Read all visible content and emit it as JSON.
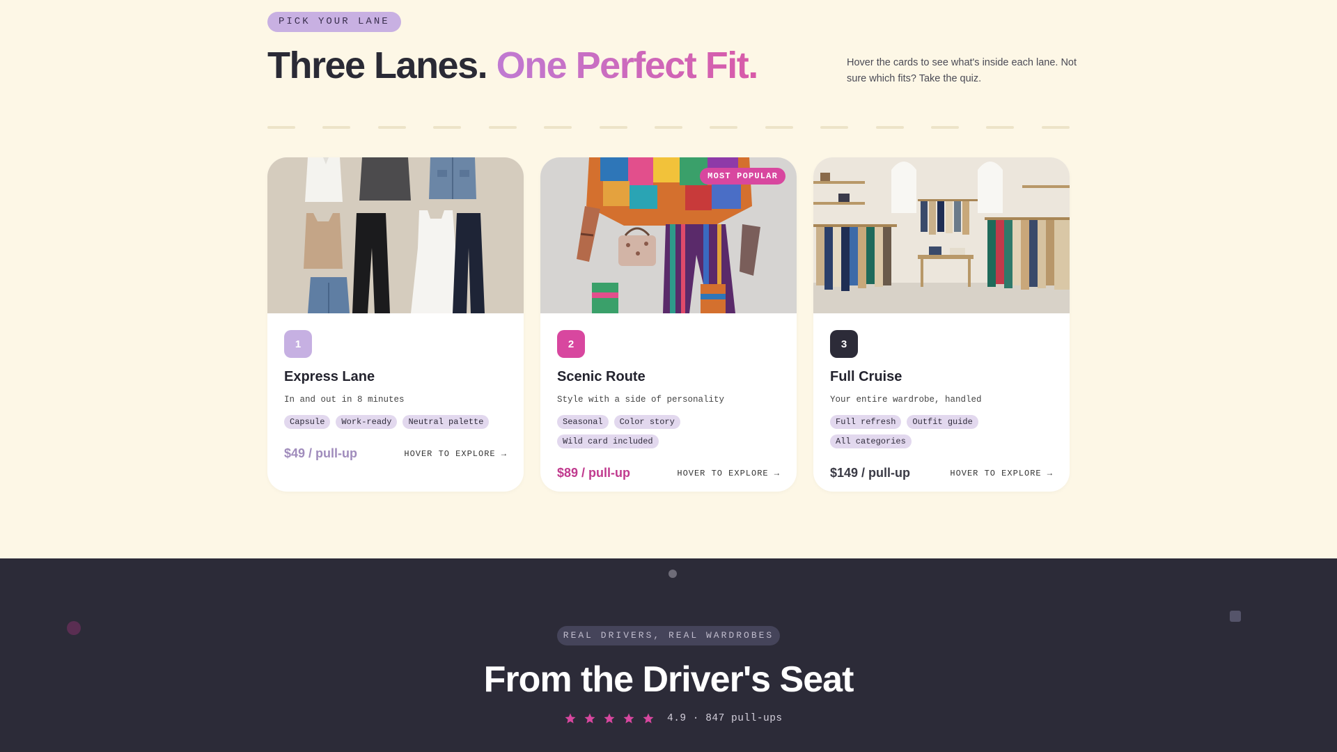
{
  "header": {
    "eyebrow": "PICK YOUR LANE",
    "headline_part1": "Three Lanes.",
    "headline_part2": "One Perfect Fit.",
    "intro": "Hover the cards to see what's inside each lane. Not sure which fits? Take the quiz."
  },
  "cards": [
    {
      "number": "1",
      "title": "Express Lane",
      "subtitle": "In and out in 8 minutes",
      "tags": [
        "Capsule",
        "Work-ready",
        "Neutral palette"
      ],
      "price": "$49 / pull-up",
      "explore": "HOVER TO EXPLORE →",
      "accent": "#c6b0e2",
      "price_color": "#a08cbc"
    },
    {
      "number": "2",
      "title": "Scenic Route",
      "subtitle": "Style with a side of personality",
      "tags": [
        "Seasonal",
        "Color story",
        "Wild card included"
      ],
      "price": "$89 / pull-up",
      "explore": "HOVER TO EXPLORE →",
      "badge": "MOST POPULAR",
      "accent": "#d8479f",
      "price_color": "#c03a8e"
    },
    {
      "number": "3",
      "title": "Full Cruise",
      "subtitle": "Your entire wardrobe, handled",
      "tags": [
        "Full refresh",
        "Outfit guide",
        "All categories"
      ],
      "price": "$149 / pull-up",
      "explore": "HOVER TO EXPLORE →",
      "accent": "#2c2b38",
      "price_color": "#3a3a45"
    }
  ],
  "testimonials": {
    "eyebrow": "REAL DRIVERS, REAL WARDROBES",
    "title": "From the Driver's Seat",
    "stars": 5,
    "rating_text": "4.9 · 847 pull-ups",
    "star_color": "#d8479f"
  },
  "colors": {
    "page_bg": "#fdf7e6",
    "dark_bg": "#2c2b38",
    "pink": "#d8479f",
    "lavender": "#c8b0e2"
  }
}
